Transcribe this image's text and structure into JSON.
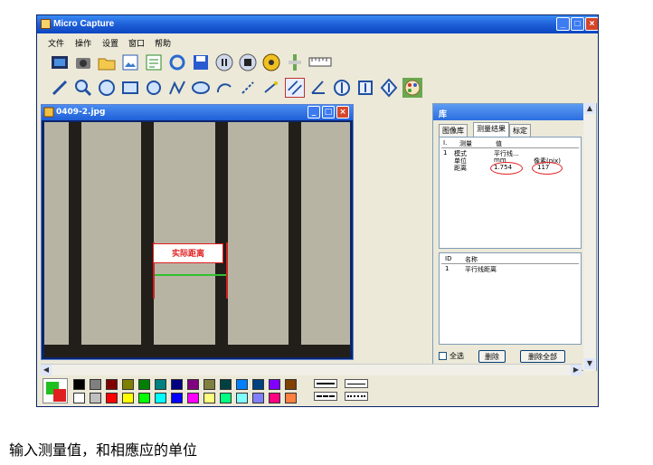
{
  "window": {
    "title": "Micro Capture"
  },
  "menu": [
    "文件",
    "操作",
    "设置",
    "窗口",
    "帮助"
  ],
  "toolbar1_icons": [
    "video-icon",
    "camera-icon",
    "folder-open-icon",
    "image-icon",
    "export-icon",
    "refresh-icon",
    "save-icon",
    "pause-icon",
    "stop-icon",
    "settings-icon",
    "brightness-icon",
    "ruler-icon"
  ],
  "toolbar2_icons": [
    "line-icon",
    "zoom-icon",
    "circle-icon",
    "rectangle-icon",
    "ellipse-icon",
    "polyline-icon",
    "ellipse2-icon",
    "arc-icon",
    "point-line-icon",
    "perpendicular-icon",
    "parallel-line-icon",
    "angle-icon",
    "measure-circle-icon",
    "measure-vertical-icon",
    "measure-center-icon",
    "palette-icon"
  ],
  "image_window": {
    "title": "0409-2.jpg",
    "annotation": "实际距离"
  },
  "panel": {
    "title": "库",
    "tabs": [
      "图像库",
      "测量结果",
      "标定"
    ],
    "result_headers": [
      "I.",
      "测量",
      "值"
    ],
    "results": [
      {
        "idx": "1",
        "name": "模式",
        "value": "平行线..."
      },
      {
        "idx": "",
        "name": "单位",
        "value": "mm"
      },
      {
        "idx": "",
        "name": "距离",
        "value": "1.754"
      }
    ],
    "pixel_header": "像素(pix)",
    "pixel_value": "117",
    "list_headers": [
      "ID",
      "名称"
    ],
    "list_rows": [
      {
        "id": "1",
        "name": "平行线距离"
      }
    ],
    "select_all": "全选",
    "delete": "删除",
    "delete_all": "删除全部"
  },
  "palette_colors": [
    "#000000",
    "#808080",
    "#800000",
    "#808000",
    "#008000",
    "#008080",
    "#000080",
    "#800080",
    "#808040",
    "#004040",
    "#0080ff",
    "#004080",
    "#8000ff",
    "#804000",
    "#ffffff",
    "#c0c0c0",
    "#ff0000",
    "#ffff00",
    "#00ff00",
    "#00ffff",
    "#0000ff",
    "#ff00ff",
    "#ffff80",
    "#00ff80",
    "#80ffff",
    "#8080ff",
    "#ff0080",
    "#ff8040"
  ],
  "caption": "输入测量值，和相應应的单位"
}
